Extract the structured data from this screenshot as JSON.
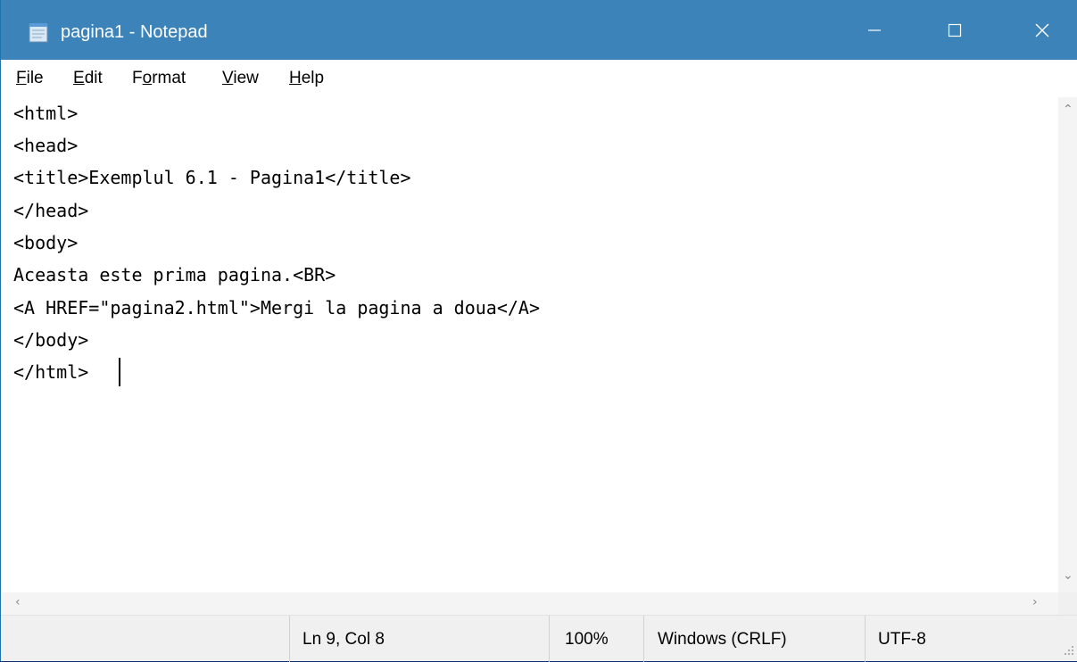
{
  "window": {
    "title": "pagina1 - Notepad",
    "icon": "notepad-icon",
    "controls": [
      "minimize-icon",
      "maximize-icon",
      "close-icon"
    ]
  },
  "menu": {
    "items": [
      {
        "mnemonic": "F",
        "rest": "ile"
      },
      {
        "mnemonic": "E",
        "rest": "dit"
      },
      {
        "pre": "F",
        "mnemonic": "o",
        "rest": "rmat"
      },
      {
        "mnemonic": "V",
        "rest": "iew"
      },
      {
        "mnemonic": "H",
        "rest": "elp"
      }
    ]
  },
  "editor": {
    "lines": [
      "<html>",
      "<head>",
      "<title>Exemplul 6.1 - Pagina1</title>",
      "</head>",
      "<body>",
      "Aceasta este prima pagina.<BR>",
      "<A HREF=\"pagina2.html\">Mergi la pagina a doua</A>",
      "</body>",
      "</html>"
    ]
  },
  "status": {
    "position": "Ln 9, Col 8",
    "zoom": "100%",
    "line_ending": "Windows (CRLF)",
    "encoding": "UTF-8"
  },
  "colors": {
    "titlebar": "#3b83b9",
    "desktop": "#0b2f6b",
    "statusbar": "#f0f0f0"
  }
}
